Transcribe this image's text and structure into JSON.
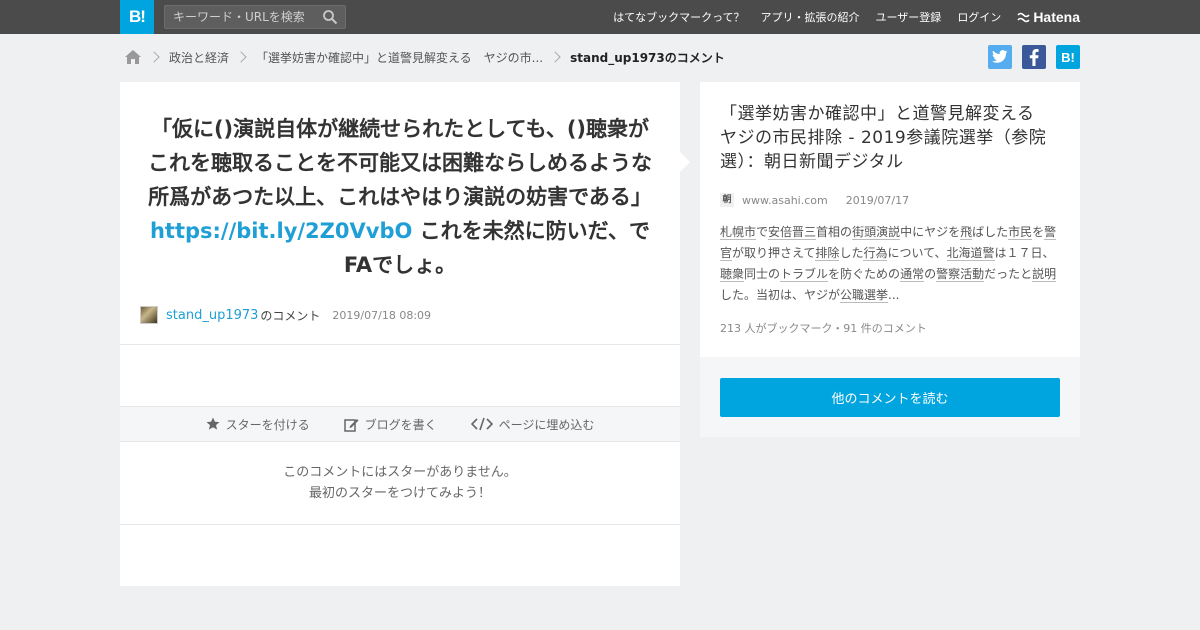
{
  "header": {
    "logo": "B!",
    "search_placeholder": "キーワード・URLを検索",
    "nav": [
      "はてなブックマークって？",
      "アプリ・拡張の紹介",
      "ユーザー登録",
      "ログイン"
    ],
    "hatena_label": "Hatena"
  },
  "breadcrumb": {
    "items": [
      "政治と経済",
      "「選挙妨害か確認中」と道警見解変える　ヤジの市..."
    ],
    "current": "stand_up1973のコメント"
  },
  "share": {
    "twitter_color": "#55acee",
    "facebook_color": "#3b5998",
    "hatena_color": "#00a4de",
    "hatena_label": "B!"
  },
  "comment": {
    "text_before": "「仮に()演説自体が継続せられたとしても、()聴衆がこれを聴取ることを不可能又は困難ならしめるような所爲があつた以上、これはやはり演説の妨害である」",
    "link": "https://bit.ly/2Z0VvbO",
    "text_after": " これを未然に防いだ、でFAでしょ。",
    "user": "stand_up1973",
    "suffix": "のコメント",
    "time": "2019/07/18 08:09"
  },
  "toolbar": {
    "star": "スターを付ける",
    "blog": "ブログを書く",
    "embed": "ページに埋め込む"
  },
  "stars": {
    "line1": "このコメントにはスターがありません。",
    "line2": "最初のスターをつけてみよう！"
  },
  "entry": {
    "title": "「選挙妨害か確認中」と道警見解変える　ヤジの市民排除 - 2019参議院選挙（参院選）：朝日新聞デジタル",
    "favicon": "朝",
    "domain": "www.asahi.com",
    "date": "2019/07/17",
    "desc": [
      {
        "t": "札幌市",
        "kw": true
      },
      {
        "t": "で",
        "kw": false
      },
      {
        "t": "安倍晋三",
        "kw": true
      },
      {
        "t": "首相の",
        "kw": false
      },
      {
        "t": "街頭演説",
        "kw": true
      },
      {
        "t": "中にヤジを",
        "kw": false
      },
      {
        "t": "飛",
        "kw": true
      },
      {
        "t": "ばした",
        "kw": false
      },
      {
        "t": "市民",
        "kw": true
      },
      {
        "t": "を",
        "kw": false
      },
      {
        "t": "警官",
        "kw": true
      },
      {
        "t": "が取り押さえて",
        "kw": false
      },
      {
        "t": "排除",
        "kw": true
      },
      {
        "t": "した",
        "kw": false
      },
      {
        "t": "行為",
        "kw": true
      },
      {
        "t": "について、",
        "kw": false
      },
      {
        "t": "北海道警",
        "kw": true
      },
      {
        "t": "は１７日、",
        "kw": false
      },
      {
        "t": "聴衆",
        "kw": true
      },
      {
        "t": "同士の",
        "kw": false
      },
      {
        "t": "トラブル",
        "kw": true
      },
      {
        "t": "を防ぐための",
        "kw": false
      },
      {
        "t": "通常",
        "kw": true
      },
      {
        "t": "の",
        "kw": false
      },
      {
        "t": "警察活動",
        "kw": true
      },
      {
        "t": "だったと",
        "kw": false
      },
      {
        "t": "説明",
        "kw": true
      },
      {
        "t": "した。当初は、ヤジが",
        "kw": false
      },
      {
        "t": "公職選挙",
        "kw": true
      },
      {
        "t": "...",
        "kw": false
      }
    ],
    "stats": "213 人がブックマーク・91 件のコメント"
  },
  "more_button": "他のコメントを読む",
  "colors": {
    "accent": "#00a4de",
    "link": "#1f9fd6",
    "topbar": "#4b4b4b"
  }
}
